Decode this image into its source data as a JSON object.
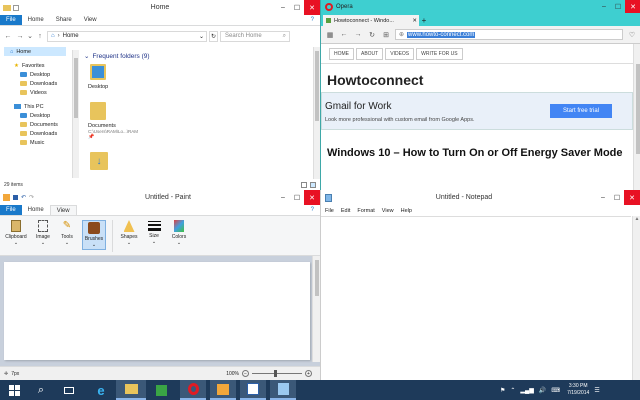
{
  "explorer": {
    "title": "Home",
    "tabs": [
      "File",
      "Home",
      "Share",
      "View"
    ],
    "address": "Home",
    "search_placeholder": "Search Home",
    "tree": [
      "Home",
      "Favorites",
      "Desktop",
      "Downloads",
      "Videos",
      "This PC",
      "Desktop",
      "Documents",
      "Downloads",
      "Music"
    ],
    "section_title": "Frequent folders (9)",
    "folders": [
      {
        "name": "Desktop",
        "sub": ""
      },
      {
        "name": "Documents",
        "sub": "C:\\Users\\RAM\\Lo...\\RAM"
      },
      {
        "name": "",
        "sub": ""
      }
    ],
    "status": "29 items"
  },
  "opera": {
    "app_label": "Opera",
    "tab_title": "Howtoconnect - Windo...",
    "url": "www.howto-connect.com",
    "site_nav": [
      "HOME",
      "ABOUT",
      "VIDEOS",
      "WRITE FOR US"
    ],
    "site_name": "Howtoconnect",
    "ad_title": "Gmail for Work",
    "ad_text": "Look more professional with custom email from Google Apps.",
    "ad_button": "Start free trial",
    "headline": "Windows 10 – How to Turn On or Off Energy Saver Mode"
  },
  "paint": {
    "title": "Untitled - Paint",
    "tabs": [
      "File",
      "Home",
      "View"
    ],
    "groups": [
      "Clipboard",
      "Image",
      "Tools",
      "Brushes",
      "Shapes",
      "Size",
      "Colors"
    ],
    "zoom": "100%",
    "status_px": "7px"
  },
  "notepad": {
    "title": "Untitled - Notepad",
    "menu": [
      "File",
      "Edit",
      "Format",
      "View",
      "Help"
    ]
  },
  "taskbar": {
    "time": "3:30 PM",
    "date": "7/19/2014",
    "accent": "#1979ca"
  }
}
